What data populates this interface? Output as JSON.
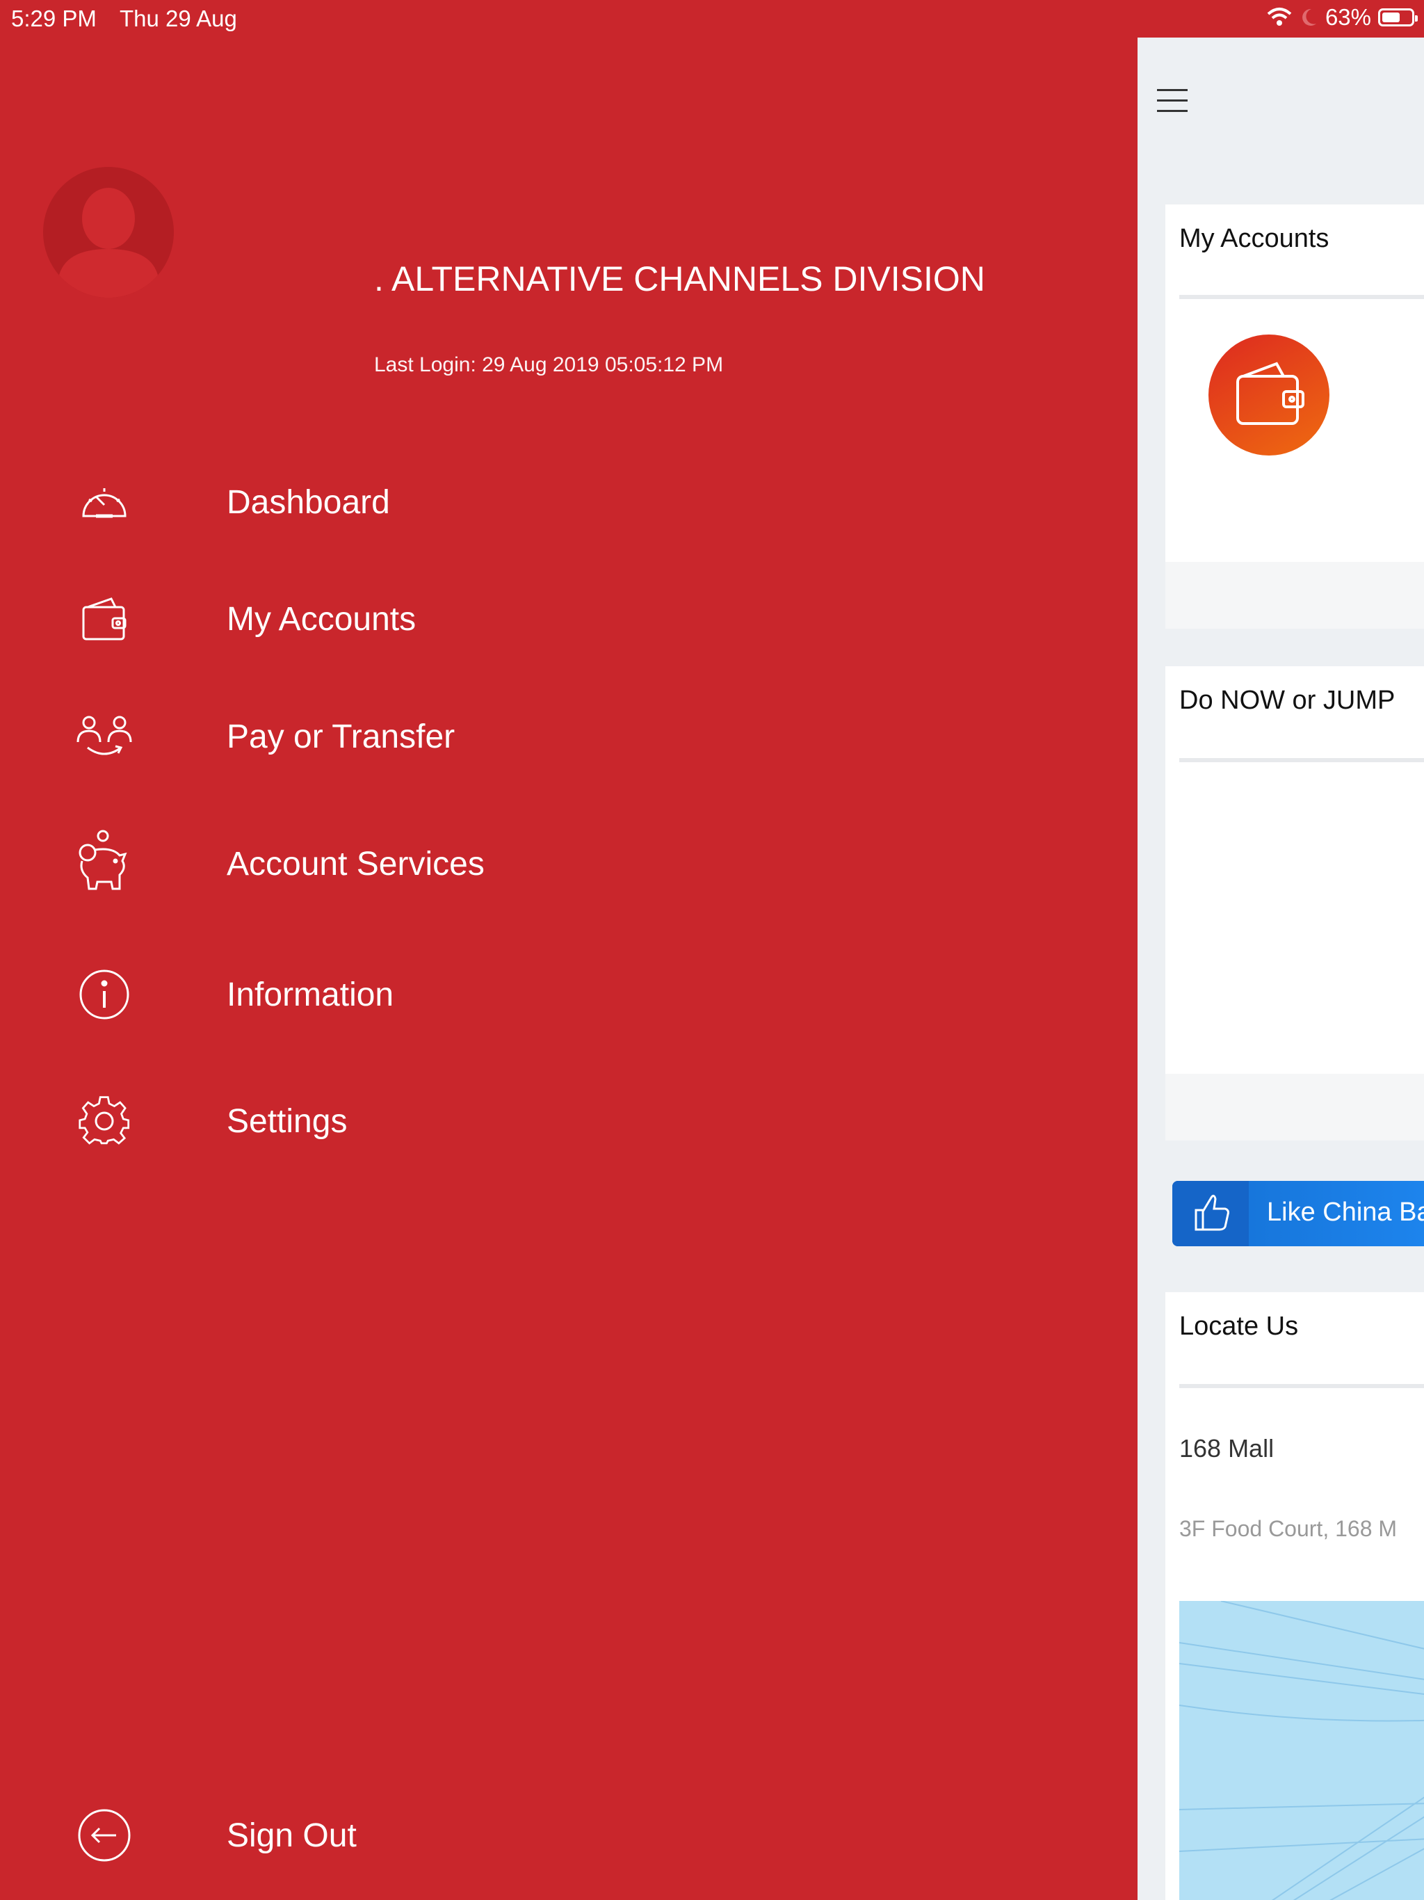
{
  "status_bar": {
    "time": "5:29 PM",
    "date": "Thu 29 Aug",
    "battery": "63%",
    "battery_level": 0.63
  },
  "drawer": {
    "user_name": ". ALTERNATIVE CHANNELS DIVISION",
    "last_login": "Last Login: 29 Aug 2019 05:05:12 PM",
    "menu": [
      {
        "label": "Dashboard",
        "icon": "speedometer-icon"
      },
      {
        "label": "My Accounts",
        "icon": "wallet-icon"
      },
      {
        "label": "Pay or Transfer",
        "icon": "transfer-icon"
      },
      {
        "label": "Account Services",
        "icon": "piggy-bank-icon"
      },
      {
        "label": "Information",
        "icon": "info-icon"
      },
      {
        "label": "Settings",
        "icon": "gear-icon"
      }
    ],
    "sign_out": {
      "label": "Sign Out",
      "icon": "sign-out-icon"
    }
  },
  "main": {
    "accounts_card": {
      "title": "My Accounts"
    },
    "do_now_card": {
      "title": "Do NOW or JUMP"
    },
    "like_bar": {
      "label": "Like China Ba"
    },
    "locate_card": {
      "title": "Locate Us",
      "place_name": "168 Mall",
      "place_address": "3F Food Court, 168 M"
    }
  },
  "colors": {
    "drawer_red": "#c9262c",
    "content_bg": "#edf0f3",
    "like_blue": "#1e7be6",
    "wallet_orange": "#e8491a"
  }
}
